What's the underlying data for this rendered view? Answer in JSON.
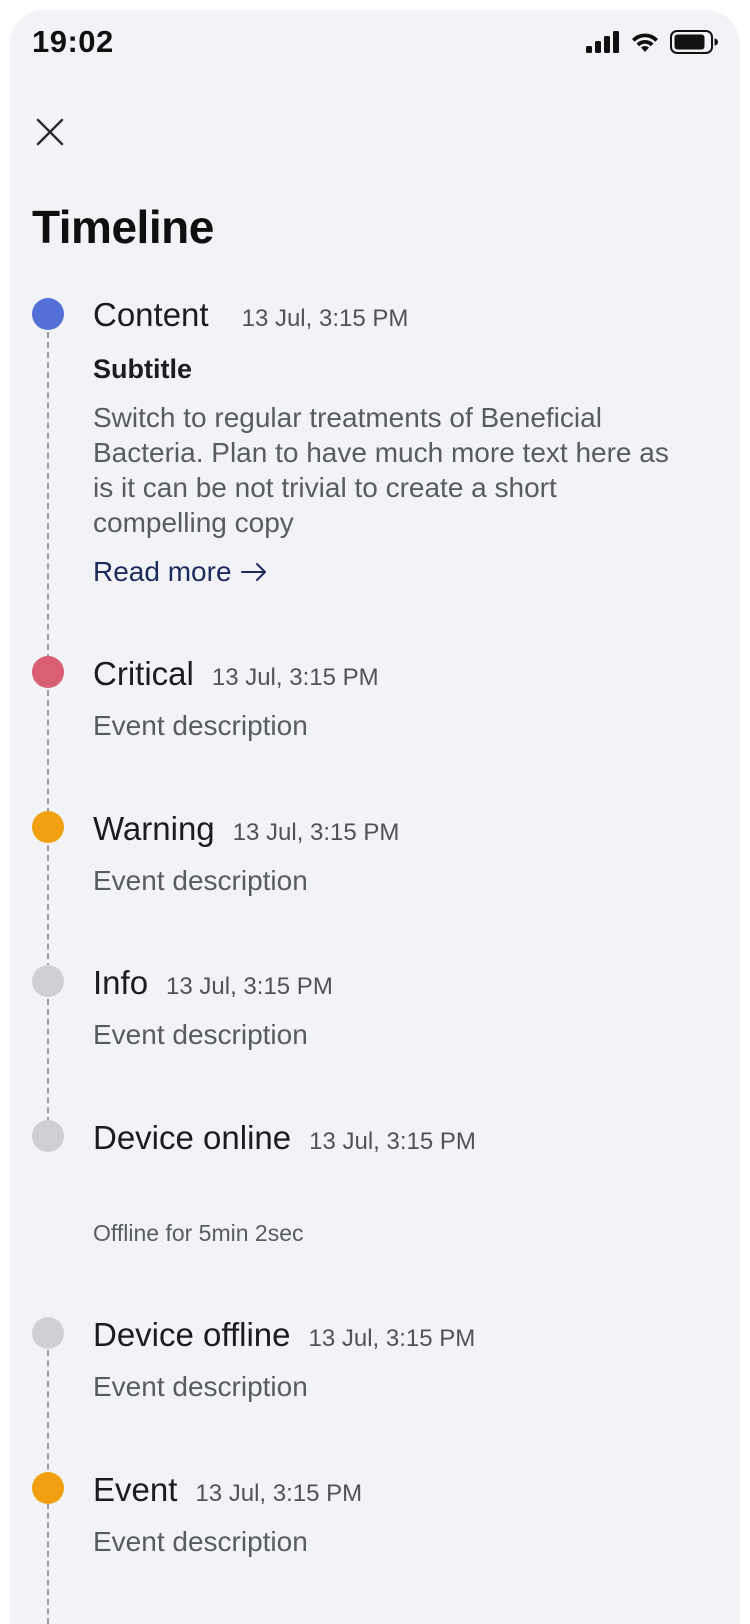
{
  "status_bar": {
    "time": "19:02",
    "icons": [
      "signal-icon",
      "wifi-icon",
      "battery-icon"
    ]
  },
  "header": {
    "close_icon": "close-icon",
    "title": "Timeline"
  },
  "colors": {
    "background": "#f2f3f7",
    "content": "#5470d6",
    "critical": "#d95f73",
    "warning": "#f0a010",
    "neutral": "#cfd0d5",
    "link": "#1d2a5c"
  },
  "events": [
    {
      "title": "Content",
      "time": "13 Jul, 3:15 PM",
      "status": "content",
      "subtitle": "Subtitle",
      "body": "Switch to regular treatments of Beneficial Bacteria. Plan to have much more text here as is it can be not trivial to create a short compelling copy",
      "link": "Read more"
    },
    {
      "title": "Critical",
      "time": "13 Jul, 3:15 PM",
      "status": "critical",
      "description": "Event description"
    },
    {
      "title": "Warning",
      "time": "13 Jul, 3:15 PM",
      "status": "warning",
      "description": "Event description"
    },
    {
      "title": "Info",
      "time": "13 Jul, 3:15 PM",
      "status": "info",
      "description": "Event description"
    },
    {
      "title": "Device online",
      "time": "13 Jul, 3:15 PM",
      "status": "online",
      "note": "Offline for 5min 2sec"
    },
    {
      "title": "Device offline",
      "time": "13 Jul, 3:15 PM",
      "status": "offline",
      "description": "Event description"
    },
    {
      "title": "Event",
      "time": "13 Jul, 3:15 PM",
      "status": "event",
      "description": "Event description"
    }
  ]
}
